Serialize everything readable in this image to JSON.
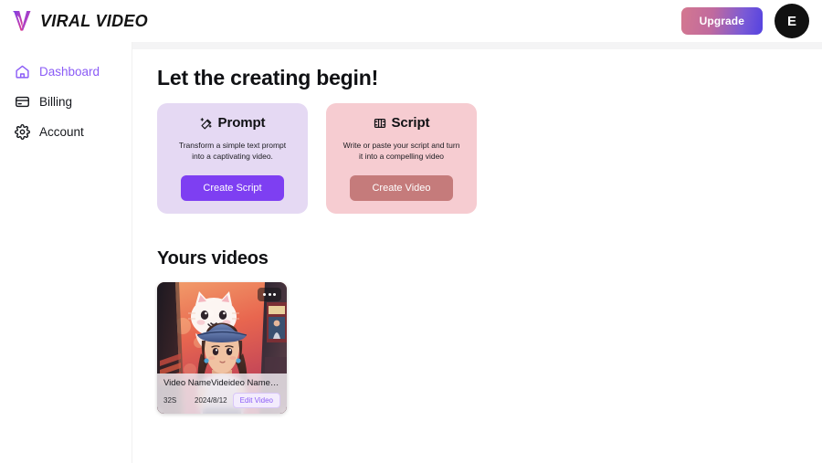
{
  "header": {
    "brand_name": "VIRAL VIDEO",
    "logo_icon": "viral-video-v-logo",
    "upgrade_label": "Upgrade",
    "avatar_initial": "E"
  },
  "sidebar": {
    "items": [
      {
        "label": "Dashboard",
        "icon": "home-icon",
        "active": true
      },
      {
        "label": "Billing",
        "icon": "credit-card-icon",
        "active": false
      },
      {
        "label": "Account",
        "icon": "gear-icon",
        "active": false
      }
    ]
  },
  "main": {
    "page_title": "Let the creating begin!",
    "action_cards": [
      {
        "id": "prompt",
        "icon": "magic-wand-icon",
        "title": "Prompt",
        "description": "Transform a simple text prompt into a captivating video.",
        "button_label": "Create Script",
        "button_style": "primary",
        "background": "#e5d9f3",
        "button_color": "#7e3ff2"
      },
      {
        "id": "script",
        "icon": "film-strip-icon",
        "title": "Script",
        "description": "Write or paste your script and turn it into a compelling video",
        "button_label": "Create Video",
        "button_style": "muted",
        "background": "#f6ccd1",
        "button_color": "#c57b7b"
      }
    ],
    "videos_section": {
      "title": "Yours videos",
      "items": [
        {
          "name": "Video NameVideideo Name V...",
          "duration": "32S",
          "date": "2024/8/12",
          "edit_label": "Edit Video",
          "menu_icon": "more-options-icon",
          "thumbnail": "anime-girl-blue-bucket-hat-with-white-cat-mural"
        }
      ]
    }
  },
  "colors": {
    "accent_purple": "#8b5cf6",
    "primary_button": "#7e3ff2",
    "muted_button": "#c57b7b",
    "prompt_card_bg": "#e5d9f3",
    "script_card_bg": "#f6ccd1",
    "avatar_bg": "#111111"
  }
}
